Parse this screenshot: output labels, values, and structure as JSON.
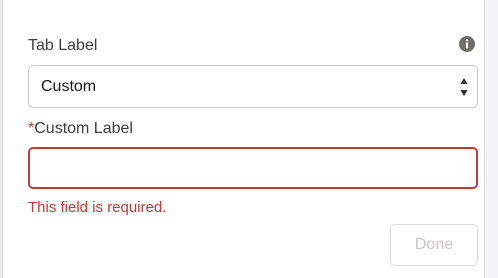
{
  "tab_label_field": {
    "label": "Tab Label",
    "selected_value": "Custom",
    "info_icon": "info-icon"
  },
  "custom_label_field": {
    "required_marker": "*",
    "label": "Custom Label",
    "value": "",
    "error": "This field is required."
  },
  "actions": {
    "done_label": "Done"
  },
  "colors": {
    "error": "#c23934",
    "disabled_text": "#c9c7c5"
  }
}
